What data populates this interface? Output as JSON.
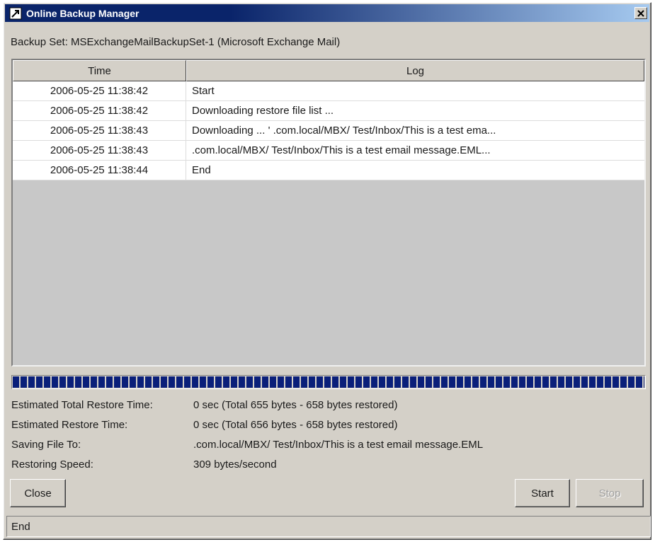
{
  "window": {
    "title": "Online Backup Manager",
    "close_glyph": "✕"
  },
  "backup_set": "Backup Set: MSExchangeMailBackupSet-1 (Microsoft Exchange Mail)",
  "table": {
    "headers": {
      "time": "Time",
      "log": "Log"
    },
    "rows": [
      {
        "time": "2006-05-25 11:38:42",
        "log": "Start"
      },
      {
        "time": "2006-05-25 11:38:42",
        "log": "Downloading restore file list ..."
      },
      {
        "time": "2006-05-25 11:38:43",
        "log": "Downloading ... '           .com.local/MBX/ Test/Inbox/This is a test ema..."
      },
      {
        "time": "2006-05-25 11:38:43",
        "log": "            .com.local/MBX/ Test/Inbox/This is a test email message.EML..."
      },
      {
        "time": "2006-05-25 11:38:44",
        "log": "End"
      }
    ]
  },
  "progress": {
    "fraction": 1.0,
    "color": "#0a1f7a"
  },
  "info": [
    {
      "label": "Estimated Total Restore Time:",
      "value": "0 sec (Total 655 bytes - 658 bytes restored)"
    },
    {
      "label": "Estimated Restore Time:",
      "value": "0 sec (Total 656 bytes - 658 bytes restored)"
    },
    {
      "label": "Saving File To:",
      "value": "            .com.local/MBX/ Test/Inbox/This is a test email message.EML"
    },
    {
      "label": "Restoring Speed:",
      "value": "309 bytes/second"
    }
  ],
  "buttons": {
    "close": "Close",
    "start": "Start",
    "stop": "Stop"
  },
  "status": "End",
  "colors": {
    "titlebar": "#0a246a",
    "window_bg": "#d4d0c8",
    "table_bg": "#c8c8c8"
  }
}
